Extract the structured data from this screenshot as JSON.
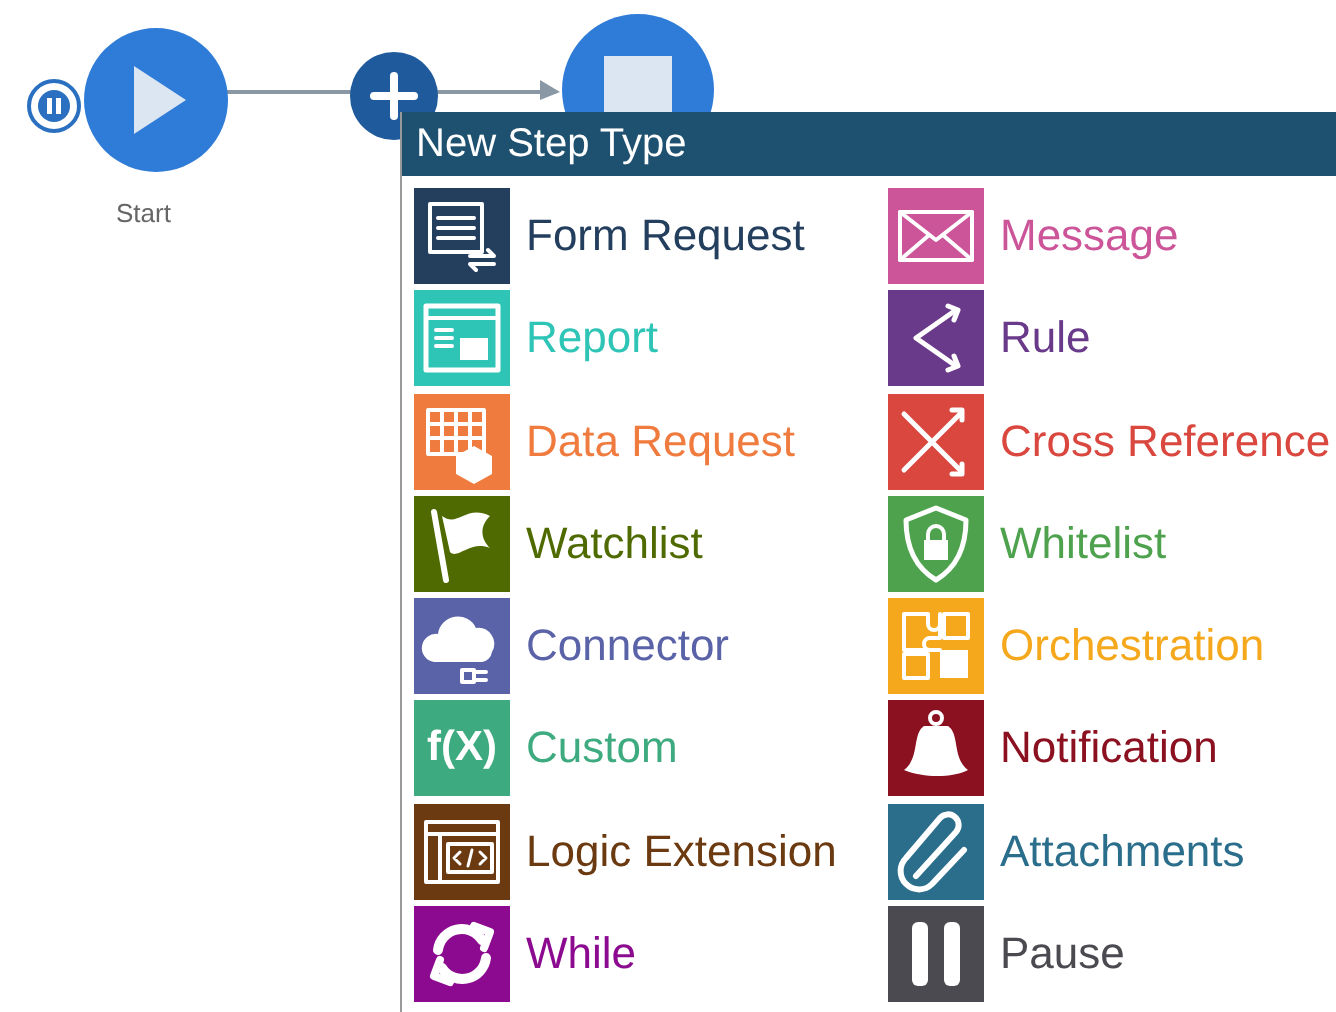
{
  "canvas": {
    "start_node": {
      "label": "Start"
    }
  },
  "menu": {
    "title": "New Step Type",
    "columns": [
      [
        {
          "label": "Form Request",
          "kind": "form",
          "color": "#243f5e"
        },
        {
          "label": "Report",
          "kind": "report",
          "color": "#2ec4b6"
        },
        {
          "label": "Data Request",
          "kind": "data",
          "color": "#f07b3f"
        },
        {
          "label": "Watchlist",
          "kind": "flag",
          "color": "#4f6a00"
        },
        {
          "label": "Connector",
          "kind": "cloud",
          "color": "#5b63a8"
        },
        {
          "label": "Custom",
          "kind": "fx",
          "icon_text": "f(X)",
          "color": "#3daa7f"
        },
        {
          "label": "Logic Extension",
          "kind": "code",
          "color": "#6b3a10"
        },
        {
          "label": "While",
          "kind": "loop",
          "color": "#8b0a8f"
        }
      ],
      [
        {
          "label": "Message",
          "kind": "mail",
          "color": "#cc5599"
        },
        {
          "label": "Rule",
          "kind": "rule",
          "color": "#6a3a8a"
        },
        {
          "label": "Cross Reference",
          "kind": "cross",
          "color": "#d9473f"
        },
        {
          "label": "Whitelist",
          "kind": "shield",
          "color": "#4ea24e"
        },
        {
          "label": "Orchestration",
          "kind": "puzzle",
          "color": "#f5a81c"
        },
        {
          "label": "Notification",
          "kind": "bell",
          "color": "#8b1020"
        },
        {
          "label": "Attachments",
          "kind": "clip",
          "color": "#2a6e8c"
        },
        {
          "label": "Pause",
          "kind": "pause",
          "color": "#4a4a50"
        }
      ]
    ]
  }
}
